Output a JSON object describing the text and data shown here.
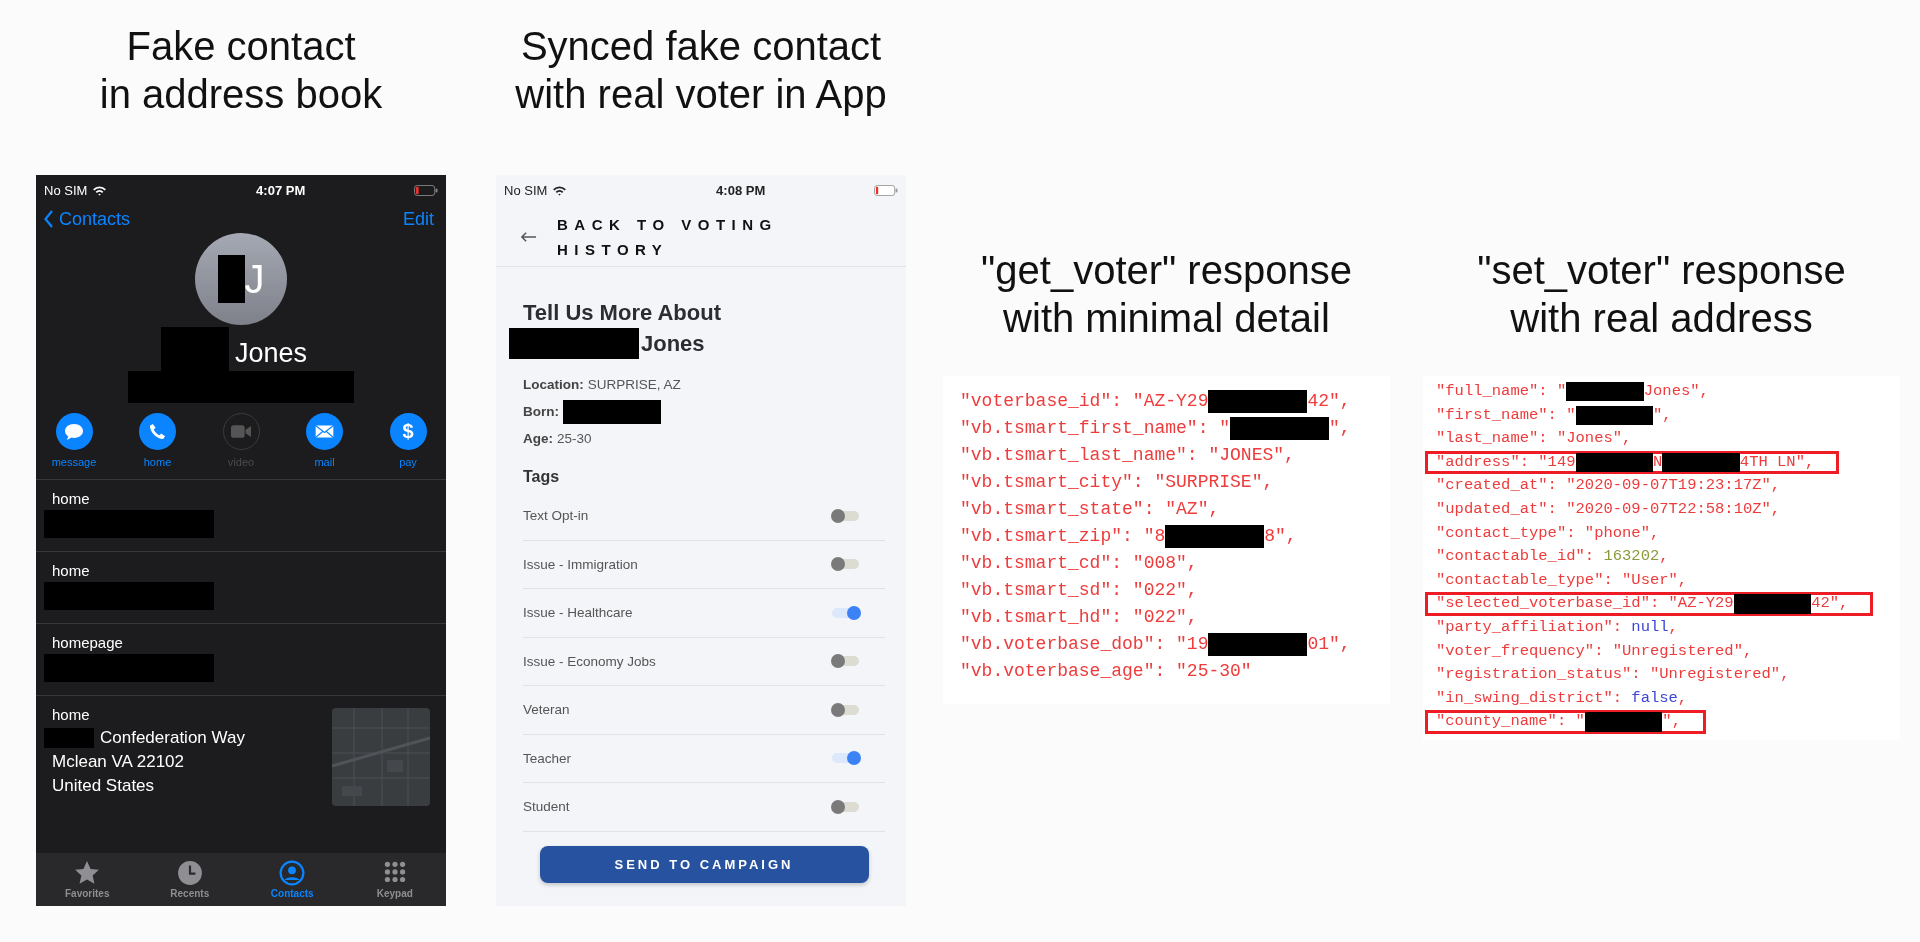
{
  "contact_screen": {
    "caption": [
      "Fake contact",
      "in address book"
    ],
    "carrier": "No SIM",
    "time": "4:07 PM",
    "back": "Contacts",
    "edit": "Edit",
    "avatar_parts": [
      {
        "kind": "redaction"
      },
      {
        "kind": "text",
        "text": "J"
      }
    ],
    "name_parts": [
      {
        "kind": "redaction"
      },
      {
        "kind": "text",
        "text": "Jones"
      }
    ],
    "subtitle_parts": [
      {
        "kind": "redaction"
      }
    ],
    "actions": [
      {
        "label": "message",
        "kind": "message",
        "disabled": false
      },
      {
        "label": "home",
        "kind": "phone",
        "disabled": false
      },
      {
        "label": "video",
        "kind": "video",
        "disabled": true
      },
      {
        "label": "mail",
        "kind": "mail",
        "disabled": false
      },
      {
        "label": "pay",
        "kind": "glyph",
        "glyph": "$",
        "disabled": false
      }
    ],
    "fields": [
      {
        "label": "home",
        "value_lines": [
          [
            {
              "kind": "redaction"
            }
          ]
        ],
        "map": false
      },
      {
        "label": "home",
        "value_lines": [
          [
            {
              "kind": "redaction"
            }
          ]
        ],
        "map": false
      },
      {
        "label": "homepage",
        "value_lines": [
          [
            {
              "kind": "redaction"
            }
          ]
        ],
        "map": false
      },
      {
        "label": "home",
        "value_lines": [
          [
            {
              "kind": "redaction"
            },
            {
              "kind": "text",
              "text": "Confederation Way"
            }
          ],
          [
            {
              "kind": "text",
              "text": "Mclean VA 22102"
            }
          ],
          [
            {
              "kind": "text",
              "text": "United States"
            }
          ]
        ],
        "map": true
      }
    ],
    "tabs": [
      {
        "label": "Favorites",
        "kind": "star",
        "selected": false
      },
      {
        "label": "Recents",
        "kind": "clock",
        "selected": false
      },
      {
        "label": "Contacts",
        "kind": "person",
        "selected": true
      },
      {
        "label": "Keypad",
        "kind": "keypad",
        "selected": false
      }
    ]
  },
  "voter_screen": {
    "caption": [
      "Synced fake contact",
      "with real voter in App"
    ],
    "carrier": "No SIM",
    "time": "4:08 PM",
    "back": "BACK TO VOTING HISTORY",
    "title_lines": [
      [
        {
          "kind": "text",
          "text": "Tell Us More About"
        }
      ],
      [
        {
          "kind": "redaction"
        },
        {
          "kind": "text",
          "text": "Jones"
        }
      ]
    ],
    "details": [
      {
        "label": "Location:",
        "value_parts": [
          {
            "kind": "text",
            "text": "SURPRISE, AZ"
          }
        ]
      },
      {
        "label": "Born:",
        "value_parts": [
          {
            "kind": "redaction"
          }
        ]
      },
      {
        "label": "Age:",
        "value_parts": [
          {
            "kind": "text",
            "text": "25-30"
          }
        ]
      }
    ],
    "tags_heading": "Tags",
    "tags": [
      {
        "label": "Text Opt-in",
        "on": false
      },
      {
        "label": "Issue - Immigration",
        "on": false
      },
      {
        "label": "Issue - Healthcare",
        "on": true
      },
      {
        "label": "Issue - Economy Jobs",
        "on": false
      },
      {
        "label": "Veteran",
        "on": false
      },
      {
        "label": "Teacher",
        "on": true
      },
      {
        "label": "Student",
        "on": false
      }
    ],
    "button": "SEND TO CAMPAIGN"
  },
  "responses": [
    {
      "caption": [
        "\"get_voter\" response",
        "with minimal detail"
      ],
      "lines": [
        {
          "highlighted": false,
          "parts": [
            {
              "kind": "string",
              "text": "\"voterbase_id\": \"AZ-Y29"
            },
            {
              "kind": "redaction"
            },
            {
              "kind": "string",
              "text": "42\","
            }
          ]
        },
        {
          "highlighted": false,
          "parts": [
            {
              "kind": "string",
              "text": "\"vb.tsmart_first_name\": \""
            },
            {
              "kind": "redaction"
            },
            {
              "kind": "string",
              "text": "\","
            }
          ]
        },
        {
          "highlighted": false,
          "parts": [
            {
              "kind": "string",
              "text": "\"vb.tsmart_last_name\": \"JONES\","
            }
          ]
        },
        {
          "highlighted": false,
          "parts": [
            {
              "kind": "string",
              "text": "\"vb.tsmart_city\": \"SURPRISE\","
            }
          ]
        },
        {
          "highlighted": false,
          "parts": [
            {
              "kind": "string",
              "text": "\"vb.tsmart_state\": \"AZ\","
            }
          ]
        },
        {
          "highlighted": false,
          "parts": [
            {
              "kind": "string",
              "text": "\"vb.tsmart_zip\": \"8"
            },
            {
              "kind": "redaction"
            },
            {
              "kind": "string",
              "text": "8\","
            }
          ]
        },
        {
          "highlighted": false,
          "parts": [
            {
              "kind": "string",
              "text": "\"vb.tsmart_cd\": \"008\","
            }
          ]
        },
        {
          "highlighted": false,
          "parts": [
            {
              "kind": "string",
              "text": "\"vb.tsmart_sd\": \"022\","
            }
          ]
        },
        {
          "highlighted": false,
          "parts": [
            {
              "kind": "string",
              "text": "\"vb.tsmart_hd\": \"022\","
            }
          ]
        },
        {
          "highlighted": false,
          "parts": [
            {
              "kind": "string",
              "text": "\"vb.voterbase_dob\": \"19"
            },
            {
              "kind": "redaction"
            },
            {
              "kind": "string",
              "text": "01\","
            }
          ]
        },
        {
          "highlighted": false,
          "parts": [
            {
              "kind": "string",
              "text": "\"vb.voterbase_age\": \"25-30\""
            }
          ]
        }
      ]
    },
    {
      "caption": [
        "\"set_voter\" response",
        "with real address"
      ],
      "lines": [
        {
          "highlighted": false,
          "parts": [
            {
              "kind": "string",
              "text": "\"full_name\": \""
            },
            {
              "kind": "redaction"
            },
            {
              "kind": "string",
              "text": "Jones\","
            }
          ]
        },
        {
          "highlighted": false,
          "parts": [
            {
              "kind": "string",
              "text": "\"first_name\": \""
            },
            {
              "kind": "redaction"
            },
            {
              "kind": "string",
              "text": "\","
            }
          ]
        },
        {
          "highlighted": false,
          "parts": [
            {
              "kind": "string",
              "text": "\"last_name\": \"Jones\","
            }
          ]
        },
        {
          "highlighted": true,
          "parts": [
            {
              "kind": "string",
              "text": "\"address\": \"149"
            },
            {
              "kind": "redaction"
            },
            {
              "kind": "string",
              "text": "N"
            },
            {
              "kind": "redaction"
            },
            {
              "kind": "string",
              "text": "4TH LN\","
            }
          ]
        },
        {
          "highlighted": false,
          "parts": [
            {
              "kind": "string",
              "text": "\"created_at\": \"2020-09-07T19:23:17Z\","
            }
          ]
        },
        {
          "highlighted": false,
          "parts": [
            {
              "kind": "string",
              "text": "\"updated_at\": \"2020-09-07T22:58:10Z\","
            }
          ]
        },
        {
          "highlighted": false,
          "parts": [
            {
              "kind": "string",
              "text": "\"contact_type\": \"phone\","
            }
          ]
        },
        {
          "highlighted": false,
          "parts": [
            {
              "kind": "string",
              "text": "\"contactable_id\":"
            },
            {
              "kind": "number",
              "text": "163202"
            },
            {
              "kind": "string",
              "text": ","
            }
          ]
        },
        {
          "highlighted": false,
          "parts": [
            {
              "kind": "string",
              "text": "\"contactable_type\": \"User\","
            }
          ]
        },
        {
          "highlighted": true,
          "parts": [
            {
              "kind": "string",
              "text": "\"selected_voterbase_id\": \"AZ-Y29"
            },
            {
              "kind": "redaction"
            },
            {
              "kind": "string",
              "text": "42\","
            }
          ]
        },
        {
          "highlighted": false,
          "parts": [
            {
              "kind": "string",
              "text": "\"party_affiliation\":"
            },
            {
              "kind": "keyword",
              "text": "null"
            },
            {
              "kind": "string",
              "text": ","
            }
          ]
        },
        {
          "highlighted": false,
          "parts": [
            {
              "kind": "string",
              "text": "\"voter_frequency\": \"Unregistered\","
            }
          ]
        },
        {
          "highlighted": false,
          "parts": [
            {
              "kind": "string",
              "text": "\"registration_status\": \"Unregistered\","
            }
          ]
        },
        {
          "highlighted": false,
          "parts": [
            {
              "kind": "string",
              "text": "\"in_swing_district\":"
            },
            {
              "kind": "keyword",
              "text": "false"
            },
            {
              "kind": "string",
              "text": ","
            }
          ]
        },
        {
          "highlighted": true,
          "parts": [
            {
              "kind": "string",
              "text": "\"county_name\": \""
            },
            {
              "kind": "redaction"
            },
            {
              "kind": "string",
              "text": "\","
            }
          ]
        }
      ]
    }
  ]
}
